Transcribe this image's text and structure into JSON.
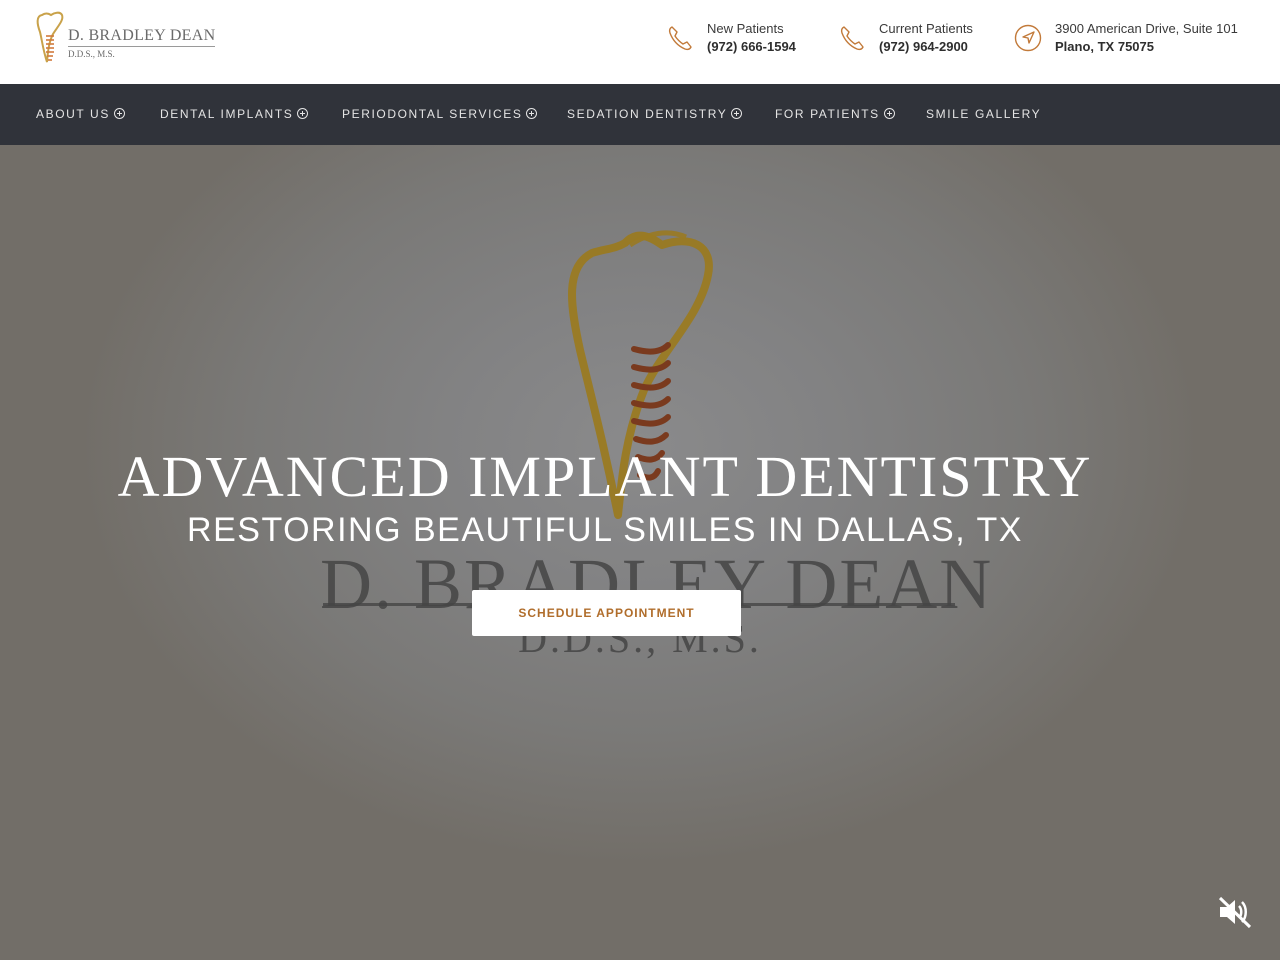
{
  "brand": {
    "name": "D. BRADLEY DEAN",
    "credentials": "D.D.S., M.S.",
    "accent": "#b8862e",
    "thread_color": "#8b3d1f"
  },
  "header": {
    "contacts": [
      {
        "label": "New Patients",
        "value": "(972) 666-1594",
        "icon": "phone-icon"
      },
      {
        "label": "Current Patients",
        "value": "(972) 964-2900",
        "icon": "phone-icon"
      },
      {
        "label": "3900 American Drive, Suite 101",
        "value": "Plano, TX 75075",
        "icon": "location-arrow-icon"
      }
    ]
  },
  "nav": {
    "items": [
      {
        "label": "ABOUT US",
        "has_submenu": true
      },
      {
        "label": "DENTAL IMPLANTS",
        "has_submenu": true
      },
      {
        "label": "PERIODONTAL SERVICES",
        "has_submenu": true
      },
      {
        "label": "SEDATION DENTISTRY",
        "has_submenu": true
      },
      {
        "label": "FOR PATIENTS",
        "has_submenu": true
      },
      {
        "label": "SMILE GALLERY",
        "has_submenu": false
      }
    ],
    "background": "#30333a"
  },
  "hero": {
    "headline": "ADVANCED IMPLANT DENTISTRY",
    "subheadline": "RESTORING BEAUTIFUL SMILES IN DALLAS, TX",
    "cta_label": "SCHEDULE APPOINTMENT",
    "cta_color": "#b06d2b",
    "background_name": "D. BRADLEY DEAN",
    "background_credentials": "D.D.S., M.S.",
    "mute_icon": "speaker-muted-icon"
  }
}
